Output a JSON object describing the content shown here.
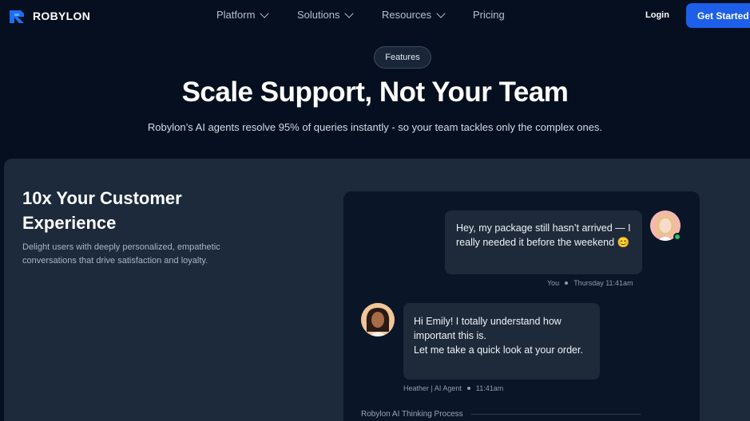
{
  "brand": {
    "name": "ROBYLON",
    "accent": "#1d5fe8"
  },
  "nav": {
    "items": [
      {
        "label": "Platform",
        "has_dropdown": true
      },
      {
        "label": "Solutions",
        "has_dropdown": true
      },
      {
        "label": "Resources",
        "has_dropdown": true
      },
      {
        "label": "Pricing",
        "has_dropdown": false
      }
    ],
    "login_label": "Login",
    "cta_label": "Get Started"
  },
  "hero": {
    "badge": "Features",
    "title": "Scale Support, Not Your Team",
    "subtitle": "Robylon’s AI agents resolve 95% of queries instantly - so your team tackles only the complex ones."
  },
  "feature": {
    "title": "10x Your Customer Experience",
    "description": "Delight users with deeply personalized, empathetic conversations that drive satisfaction and loyalty."
  },
  "chat": {
    "user_message": "Hey, my package still hasn’t arrived — I really needed it before the weekend 😊",
    "user_meta": {
      "sender": "You",
      "time": "Thursday 11:41am"
    },
    "agent_message_line1": "Hi Emily! I totally understand how important this is.",
    "agent_message_line2": "Let me take a quick look at your order.",
    "agent_meta": {
      "sender": "Heather | AI Agent",
      "time": "11:41am"
    },
    "thinking_label": "Robylon AI Thinking Process"
  },
  "icons": {
    "logo": "robylon-logo-icon",
    "chevron": "chevron-down-icon",
    "user_avatar": "emily-avatar",
    "agent_avatar": "heather-avatar"
  }
}
